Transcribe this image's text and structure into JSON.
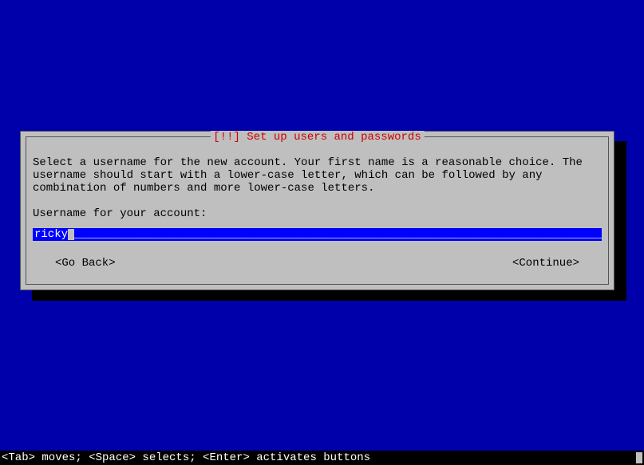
{
  "dialog": {
    "title": "[!!] Set up users and passwords",
    "description": "Select a username for the new account. Your first name is a reasonable choice. The username should start with a lower-case letter, which can be followed by any combination of numbers and more lower-case letters.",
    "prompt": "Username for your account:",
    "input_value": "ricky",
    "go_back": "<Go Back>",
    "continue": "<Continue>"
  },
  "statusbar": {
    "text": "<Tab> moves; <Space> selects; <Enter> activates buttons"
  }
}
